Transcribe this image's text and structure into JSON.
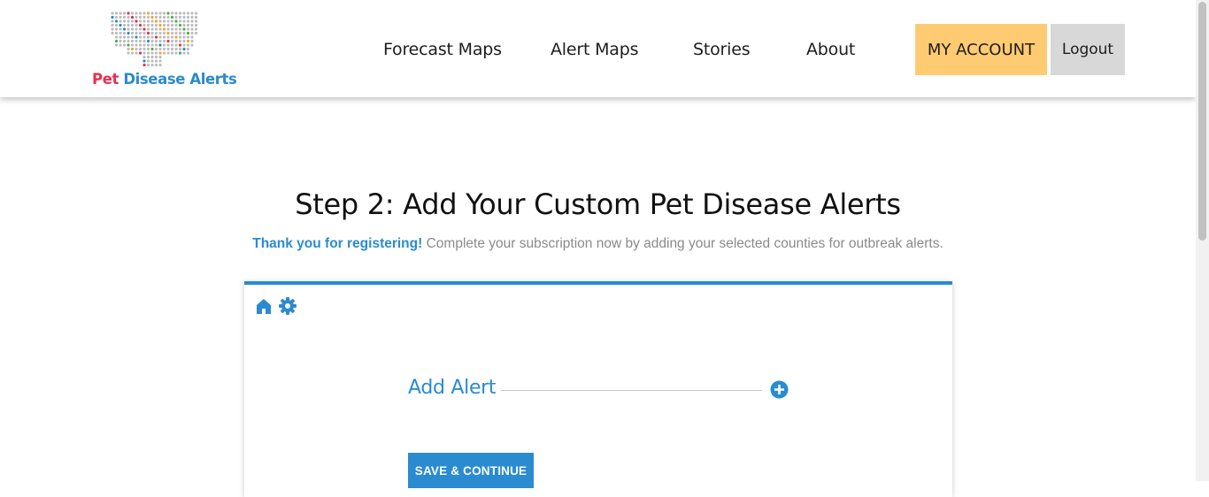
{
  "header": {
    "logo": {
      "pet": "Pet",
      "rest": " Disease Alerts"
    },
    "nav": {
      "forecast_maps": "Forecast Maps",
      "alert_maps": "Alert Maps",
      "stories": "Stories",
      "about": "About"
    },
    "my_account": "MY ACCOUNT",
    "logout": "Logout"
  },
  "main": {
    "title": "Step 2: Add Your Custom Pet Disease Alerts",
    "thanks": "Thank you for registering!",
    "subtitle": " Complete your subscription now by adding your selected counties for outbreak alerts."
  },
  "card": {
    "icons": [
      "home-icon",
      "gear-icon"
    ],
    "add_alert": "Add Alert",
    "save_continue": "SAVE & CONTINUE"
  },
  "colors": {
    "brand_blue": "#2a8bd0",
    "brand_red": "#e8304e",
    "account_yellow": "#ffcb72",
    "logout_gray": "#d8d8d8"
  }
}
